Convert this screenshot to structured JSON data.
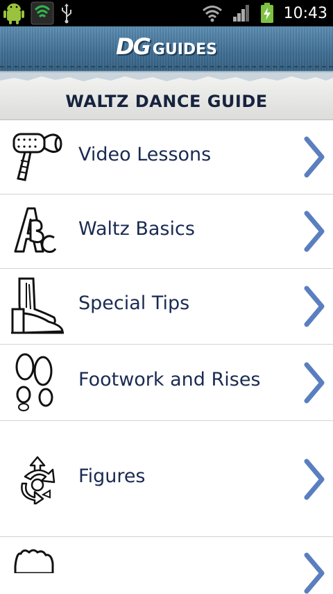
{
  "status_bar": {
    "time": "10:43"
  },
  "header": {
    "logo_mark": "DG",
    "logo_text": "GUIDES"
  },
  "banner": {
    "title": "WALTZ DANCE GUIDE"
  },
  "menu": {
    "items": [
      {
        "label": "Video Lessons",
        "icon": "video-camera-icon"
      },
      {
        "label": "Waltz Basics",
        "icon": "abc-icon"
      },
      {
        "label": "Special Tips",
        "icon": "dance-shoes-icon"
      },
      {
        "label": "Footwork and Rises",
        "icon": "footprints-icon"
      },
      {
        "label": "Figures",
        "icon": "figures-arrows-icon"
      },
      {
        "label": "",
        "icon": "partial-icon"
      }
    ]
  },
  "colors": {
    "accent": "#5a7fc0",
    "text": "#1a2a52",
    "header": "#4a7aa0"
  }
}
